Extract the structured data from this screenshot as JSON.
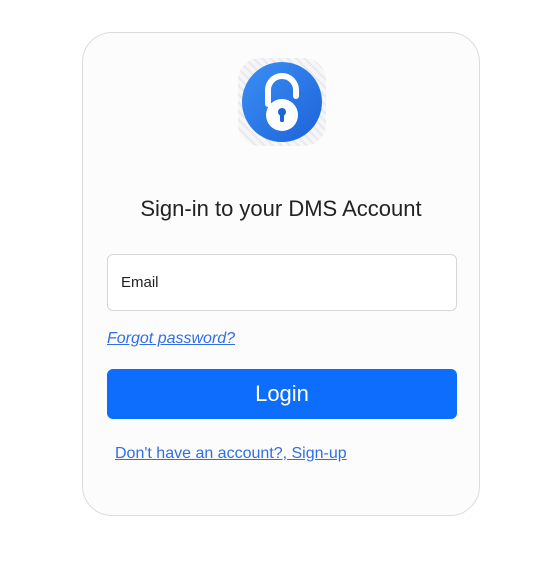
{
  "login_card": {
    "logo_icon": "padlock-icon",
    "accent_color": "#0d6efd",
    "title": "Sign-in to your DMS Account",
    "email": {
      "value": "",
      "placeholder": "Email"
    },
    "forgot_password_link": "Forgot password?",
    "login_button": "Login",
    "signup_link": "Don't have an account?, Sign-up"
  }
}
